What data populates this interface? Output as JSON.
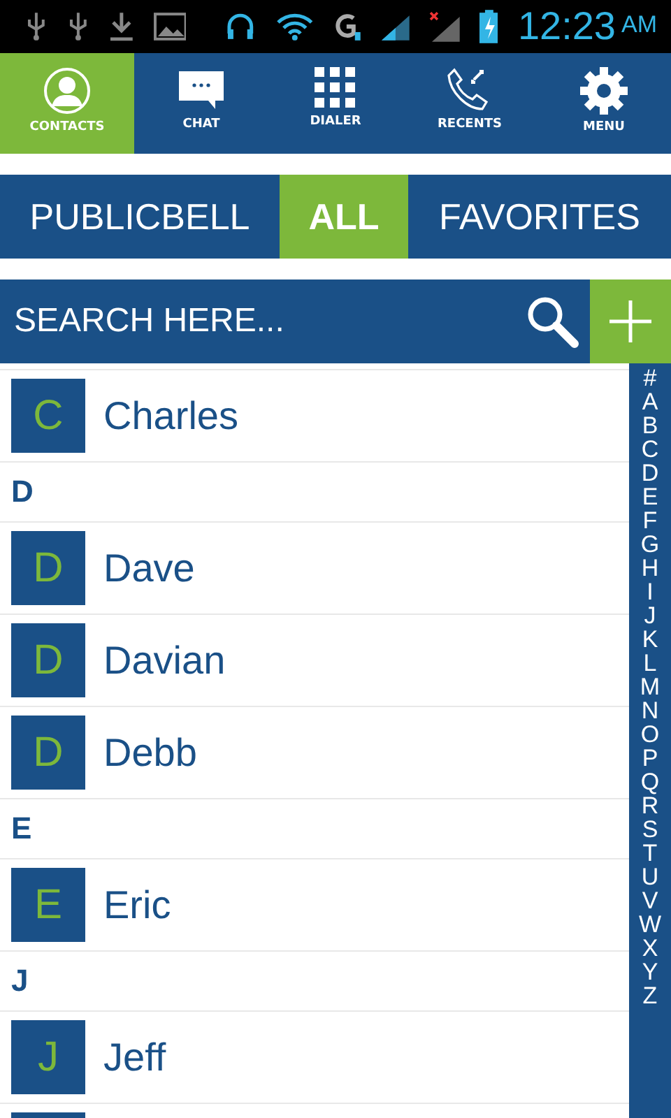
{
  "status_bar": {
    "time": "12:23",
    "meridiem": "AM"
  },
  "nav": [
    {
      "label": "CONTACTS",
      "kind": "person",
      "selected": true
    },
    {
      "label": "CHAT",
      "kind": "chat",
      "selected": false
    },
    {
      "label": "DIALER",
      "kind": "dialpad",
      "selected": false
    },
    {
      "label": "RECENTS",
      "kind": "phone",
      "selected": false
    },
    {
      "label": "MENU",
      "kind": "gear",
      "selected": false
    }
  ],
  "tabs": [
    {
      "label": "PUBLICBELL",
      "selected": false
    },
    {
      "label": "ALL",
      "selected": true
    },
    {
      "label": "FAVORITES",
      "selected": false
    }
  ],
  "search": {
    "placeholder": "SEARCH HERE..."
  },
  "contacts": [
    {
      "kind": "contact",
      "initial": "C",
      "name": "Charles"
    },
    {
      "kind": "header",
      "label": "D"
    },
    {
      "kind": "contact",
      "initial": "D",
      "name": "Dave"
    },
    {
      "kind": "contact",
      "initial": "D",
      "name": "Davian"
    },
    {
      "kind": "contact",
      "initial": "D",
      "name": "Debb"
    },
    {
      "kind": "header",
      "label": "E"
    },
    {
      "kind": "contact",
      "initial": "E",
      "name": "Eric"
    },
    {
      "kind": "header",
      "label": "J"
    },
    {
      "kind": "contact",
      "initial": "J",
      "name": "Jeff"
    },
    {
      "kind": "partial"
    }
  ],
  "index": [
    "#",
    "A",
    "B",
    "C",
    "D",
    "E",
    "F",
    "G",
    "H",
    "I",
    "J",
    "K",
    "L",
    "M",
    "N",
    "O",
    "P",
    "Q",
    "R",
    "S",
    "T",
    "U",
    "V",
    "W",
    "X",
    "Y",
    "Z"
  ]
}
